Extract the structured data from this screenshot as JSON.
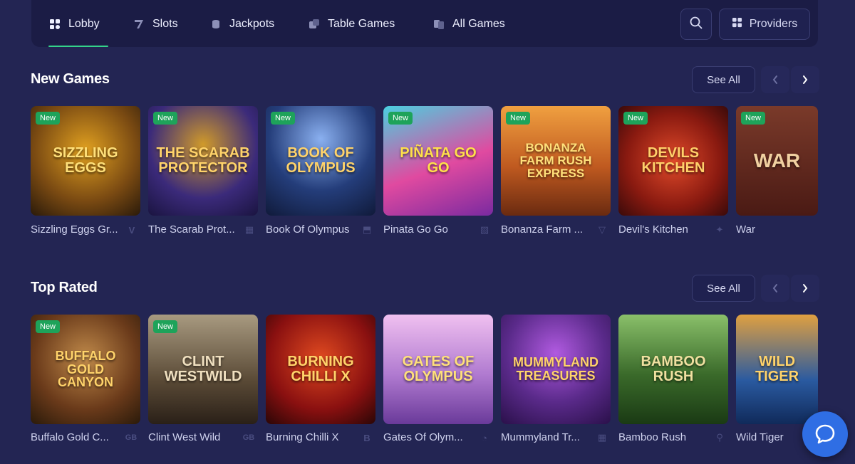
{
  "nav": {
    "tabs": [
      {
        "label": "Lobby",
        "icon": "grid-icon"
      },
      {
        "label": "Slots",
        "icon": "seven-icon"
      },
      {
        "label": "Jackpots",
        "icon": "coin-stack-icon"
      },
      {
        "label": "Table Games",
        "icon": "dice-icon"
      },
      {
        "label": "All Games",
        "icon": "cards-icon"
      }
    ],
    "providers_label": "Providers"
  },
  "sections": [
    {
      "title": "New Games",
      "see_all": "See All",
      "games": [
        {
          "label": "Sizzling Eggs Gr...",
          "art": "SIZZLING EGGS",
          "new": "New",
          "color": "#7a4a12"
        },
        {
          "label": "The Scarab Prot...",
          "art": "THE SCARAB PROTECTOR",
          "new": "New",
          "color": "#3b2a7a"
        },
        {
          "label": "Book Of Olympus",
          "art": "BOOK OF OLYMPUS",
          "new": "New",
          "color": "#243d7a"
        },
        {
          "label": "Pinata Go Go",
          "art": "PIÑATA GO GO",
          "new": "New",
          "color": "#c2307a"
        },
        {
          "label": "Bonanza Farm ...",
          "art": "BONANZA FARM RUSH EXPRESS",
          "new": "New",
          "color": "#b8741a"
        },
        {
          "label": "Devil's Kitchen",
          "art": "DEVILS KITCHEN",
          "new": "New",
          "color": "#a3241a"
        },
        {
          "label": "War",
          "art": "WAR",
          "new": "New",
          "color": "#6a2a1e"
        }
      ]
    },
    {
      "title": "Top Rated",
      "see_all": "See All",
      "games": [
        {
          "label": "Buffalo Gold C...",
          "art": "BUFFALO GOLD CANYON",
          "new": "New",
          "color": "#8a5a2a"
        },
        {
          "label": "Clint West Wild",
          "art": "CLINT WESTWILD",
          "new": "New",
          "color": "#5a4a36"
        },
        {
          "label": "Burning Chilli X",
          "art": "BURNING CHILLI X",
          "new": "",
          "color": "#9a1a14"
        },
        {
          "label": "Gates Of Olym...",
          "art": "GATES OF OLYMPUS",
          "new": "",
          "color": "#c79ae0"
        },
        {
          "label": "Mummyland Tr...",
          "art": "MUMMYLAND TREASURES",
          "new": "",
          "color": "#5a2a8a"
        },
        {
          "label": "Bamboo Rush",
          "art": "BAMBOO RUSH",
          "new": "",
          "color": "#3a6a2a"
        },
        {
          "label": "Wild Tiger",
          "art": "WILD TIGER",
          "new": "",
          "color": "#2a5aa0"
        }
      ]
    }
  ],
  "provider_marks": [
    "V",
    "▦",
    "⬒",
    "▧",
    "▽",
    "✦",
    "GB",
    "GB",
    "B",
    "◔",
    "▦",
    "⚲"
  ],
  "colors": {
    "background": "#232553",
    "nav": "#1b1c45",
    "accent": "#34d48a",
    "new_badge": "#1ea35a",
    "chat": "#2f6ee4"
  }
}
